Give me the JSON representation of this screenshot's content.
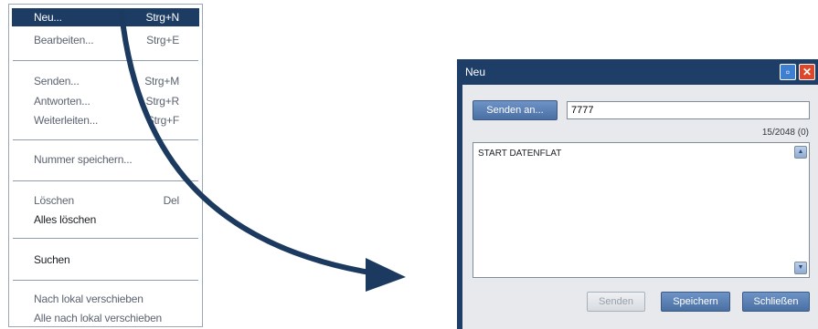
{
  "context_menu": {
    "items": [
      {
        "label": "Neu...",
        "shortcut": "Strg+N"
      },
      {
        "label": "Bearbeiten...",
        "shortcut": "Strg+E"
      },
      {
        "label": "Senden...",
        "shortcut": "Strg+M"
      },
      {
        "label": "Antworten...",
        "shortcut": "Strg+R"
      },
      {
        "label": "Weiterleiten...",
        "shortcut": "Strg+F"
      },
      {
        "label": "Nummer speichern..."
      },
      {
        "label": "Löschen",
        "shortcut": "Del"
      },
      {
        "label": "Alles löschen"
      },
      {
        "label": "Suchen"
      },
      {
        "label": "Nach lokal verschieben"
      },
      {
        "label": "Alle nach lokal verschieben"
      }
    ],
    "highlight_color": "#1c3c63"
  },
  "dialog": {
    "title": "Neu",
    "send_to_button": "Senden an...",
    "recipient_value": "7777",
    "char_counter": "15/2048 (0)",
    "message_text": "START DATENFLAT",
    "buttons": {
      "send": "Senden",
      "save": "Speichern",
      "close": "Schließen"
    },
    "title_bar_color": "#1e3e67",
    "close_button_color": "#e0462a"
  },
  "icons": {
    "minimize": "minimize-icon",
    "close": "close-icon",
    "scroll_up": "scroll-up-icon",
    "scroll_down": "scroll-down-icon",
    "arrow": "curved-arrow-icon"
  }
}
